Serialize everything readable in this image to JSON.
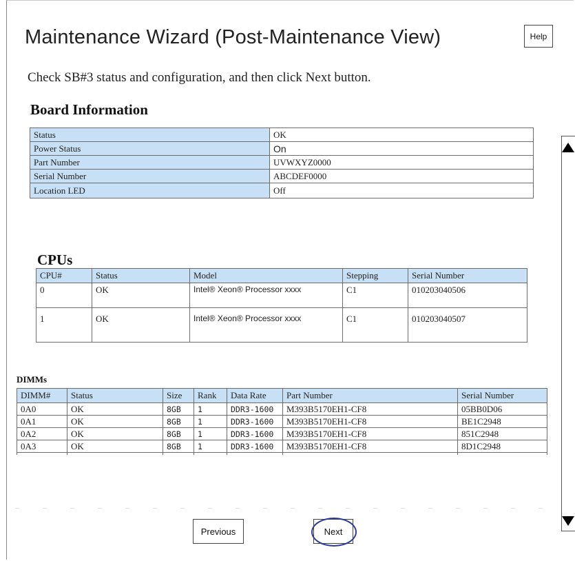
{
  "window": {
    "title": "Maintenance Wizard (Post-Maintenance View)",
    "help_label": "Help",
    "instruction": "Check SB#3 status and configuration, and then click Next button."
  },
  "board": {
    "heading": "Board Information",
    "rows": [
      {
        "label": "Status",
        "value": "OK"
      },
      {
        "label": "Power Status",
        "value": "On"
      },
      {
        "label": "Part Number",
        "value": "UVWXYZ0000"
      },
      {
        "label": "Serial Number",
        "value": "ABCDEF0000"
      },
      {
        "label": "Location LED",
        "value": "Off"
      }
    ]
  },
  "cpus": {
    "heading": "CPUs",
    "columns": [
      "CPU#",
      "Status",
      "Model",
      "Stepping",
      "Serial Number"
    ],
    "rows": [
      [
        "0",
        "OK",
        "Intel® Xeon® Processor xxxx",
        "C1",
        "010203040506"
      ],
      [
        "1",
        "OK",
        "Intel® Xeon® Processor xxxx",
        "C1",
        "010203040507"
      ]
    ]
  },
  "dimms": {
    "heading": "DIMMs",
    "columns": [
      "DIMM#",
      "Status",
      "Size",
      "Rank",
      "Data Rate",
      "Part Number",
      "Serial Number"
    ],
    "rows": [
      [
        "0A0",
        "OK",
        "8GB",
        "1",
        "DDR3-1600",
        "M393B5170EH1-CF8",
        "05BB0D06"
      ],
      [
        "0A1",
        "OK",
        "8GB",
        "1",
        "DDR3-1600",
        "M393B5170EH1-CF8",
        "BE1C2948"
      ],
      [
        "0A2",
        "OK",
        "8GB",
        "1",
        "DDR3-1600",
        "M393B5170EH1-CF8",
        "851C2948"
      ],
      [
        "0A3",
        "OK",
        "8GB",
        "1",
        "DDR3-1600",
        "M393B5170EH1-CF8",
        "8D1C2948"
      ]
    ]
  },
  "nav": {
    "previous_label": "Previous",
    "next_label": "Next"
  },
  "icons": {
    "scroll_up": "triangle-up",
    "scroll_down": "triangle-down"
  },
  "colors": {
    "header_bg": "#c7e0f6",
    "highlight_ring": "#2c3a9c"
  }
}
